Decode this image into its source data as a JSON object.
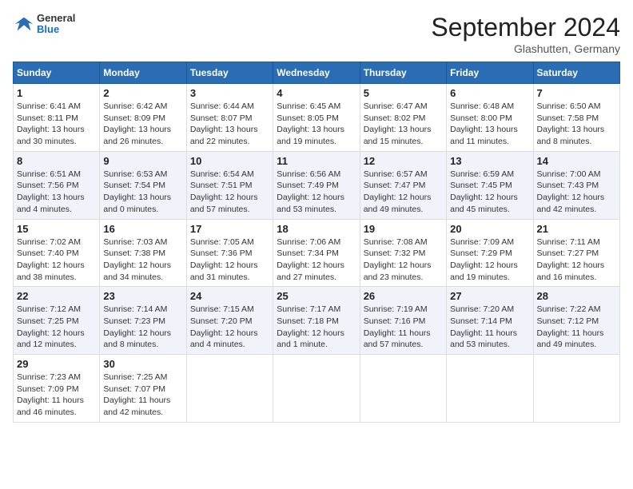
{
  "header": {
    "logo_general": "General",
    "logo_blue": "Blue",
    "month": "September 2024",
    "location": "Glashutten, Germany"
  },
  "weekdays": [
    "Sunday",
    "Monday",
    "Tuesday",
    "Wednesday",
    "Thursday",
    "Friday",
    "Saturday"
  ],
  "weeks": [
    [
      {
        "day": "1",
        "sunrise": "Sunrise: 6:41 AM",
        "sunset": "Sunset: 8:11 PM",
        "daylight": "Daylight: 13 hours and 30 minutes."
      },
      {
        "day": "2",
        "sunrise": "Sunrise: 6:42 AM",
        "sunset": "Sunset: 8:09 PM",
        "daylight": "Daylight: 13 hours and 26 minutes."
      },
      {
        "day": "3",
        "sunrise": "Sunrise: 6:44 AM",
        "sunset": "Sunset: 8:07 PM",
        "daylight": "Daylight: 13 hours and 22 minutes."
      },
      {
        "day": "4",
        "sunrise": "Sunrise: 6:45 AM",
        "sunset": "Sunset: 8:05 PM",
        "daylight": "Daylight: 13 hours and 19 minutes."
      },
      {
        "day": "5",
        "sunrise": "Sunrise: 6:47 AM",
        "sunset": "Sunset: 8:02 PM",
        "daylight": "Daylight: 13 hours and 15 minutes."
      },
      {
        "day": "6",
        "sunrise": "Sunrise: 6:48 AM",
        "sunset": "Sunset: 8:00 PM",
        "daylight": "Daylight: 13 hours and 11 minutes."
      },
      {
        "day": "7",
        "sunrise": "Sunrise: 6:50 AM",
        "sunset": "Sunset: 7:58 PM",
        "daylight": "Daylight: 13 hours and 8 minutes."
      }
    ],
    [
      {
        "day": "8",
        "sunrise": "Sunrise: 6:51 AM",
        "sunset": "Sunset: 7:56 PM",
        "daylight": "Daylight: 13 hours and 4 minutes."
      },
      {
        "day": "9",
        "sunrise": "Sunrise: 6:53 AM",
        "sunset": "Sunset: 7:54 PM",
        "daylight": "Daylight: 13 hours and 0 minutes."
      },
      {
        "day": "10",
        "sunrise": "Sunrise: 6:54 AM",
        "sunset": "Sunset: 7:51 PM",
        "daylight": "Daylight: 12 hours and 57 minutes."
      },
      {
        "day": "11",
        "sunrise": "Sunrise: 6:56 AM",
        "sunset": "Sunset: 7:49 PM",
        "daylight": "Daylight: 12 hours and 53 minutes."
      },
      {
        "day": "12",
        "sunrise": "Sunrise: 6:57 AM",
        "sunset": "Sunset: 7:47 PM",
        "daylight": "Daylight: 12 hours and 49 minutes."
      },
      {
        "day": "13",
        "sunrise": "Sunrise: 6:59 AM",
        "sunset": "Sunset: 7:45 PM",
        "daylight": "Daylight: 12 hours and 45 minutes."
      },
      {
        "day": "14",
        "sunrise": "Sunrise: 7:00 AM",
        "sunset": "Sunset: 7:43 PM",
        "daylight": "Daylight: 12 hours and 42 minutes."
      }
    ],
    [
      {
        "day": "15",
        "sunrise": "Sunrise: 7:02 AM",
        "sunset": "Sunset: 7:40 PM",
        "daylight": "Daylight: 12 hours and 38 minutes."
      },
      {
        "day": "16",
        "sunrise": "Sunrise: 7:03 AM",
        "sunset": "Sunset: 7:38 PM",
        "daylight": "Daylight: 12 hours and 34 minutes."
      },
      {
        "day": "17",
        "sunrise": "Sunrise: 7:05 AM",
        "sunset": "Sunset: 7:36 PM",
        "daylight": "Daylight: 12 hours and 31 minutes."
      },
      {
        "day": "18",
        "sunrise": "Sunrise: 7:06 AM",
        "sunset": "Sunset: 7:34 PM",
        "daylight": "Daylight: 12 hours and 27 minutes."
      },
      {
        "day": "19",
        "sunrise": "Sunrise: 7:08 AM",
        "sunset": "Sunset: 7:32 PM",
        "daylight": "Daylight: 12 hours and 23 minutes."
      },
      {
        "day": "20",
        "sunrise": "Sunrise: 7:09 AM",
        "sunset": "Sunset: 7:29 PM",
        "daylight": "Daylight: 12 hours and 19 minutes."
      },
      {
        "day": "21",
        "sunrise": "Sunrise: 7:11 AM",
        "sunset": "Sunset: 7:27 PM",
        "daylight": "Daylight: 12 hours and 16 minutes."
      }
    ],
    [
      {
        "day": "22",
        "sunrise": "Sunrise: 7:12 AM",
        "sunset": "Sunset: 7:25 PM",
        "daylight": "Daylight: 12 hours and 12 minutes."
      },
      {
        "day": "23",
        "sunrise": "Sunrise: 7:14 AM",
        "sunset": "Sunset: 7:23 PM",
        "daylight": "Daylight: 12 hours and 8 minutes."
      },
      {
        "day": "24",
        "sunrise": "Sunrise: 7:15 AM",
        "sunset": "Sunset: 7:20 PM",
        "daylight": "Daylight: 12 hours and 4 minutes."
      },
      {
        "day": "25",
        "sunrise": "Sunrise: 7:17 AM",
        "sunset": "Sunset: 7:18 PM",
        "daylight": "Daylight: 12 hours and 1 minute."
      },
      {
        "day": "26",
        "sunrise": "Sunrise: 7:19 AM",
        "sunset": "Sunset: 7:16 PM",
        "daylight": "Daylight: 11 hours and 57 minutes."
      },
      {
        "day": "27",
        "sunrise": "Sunrise: 7:20 AM",
        "sunset": "Sunset: 7:14 PM",
        "daylight": "Daylight: 11 hours and 53 minutes."
      },
      {
        "day": "28",
        "sunrise": "Sunrise: 7:22 AM",
        "sunset": "Sunset: 7:12 PM",
        "daylight": "Daylight: 11 hours and 49 minutes."
      }
    ],
    [
      {
        "day": "29",
        "sunrise": "Sunrise: 7:23 AM",
        "sunset": "Sunset: 7:09 PM",
        "daylight": "Daylight: 11 hours and 46 minutes."
      },
      {
        "day": "30",
        "sunrise": "Sunrise: 7:25 AM",
        "sunset": "Sunset: 7:07 PM",
        "daylight": "Daylight: 11 hours and 42 minutes."
      },
      null,
      null,
      null,
      null,
      null
    ]
  ]
}
